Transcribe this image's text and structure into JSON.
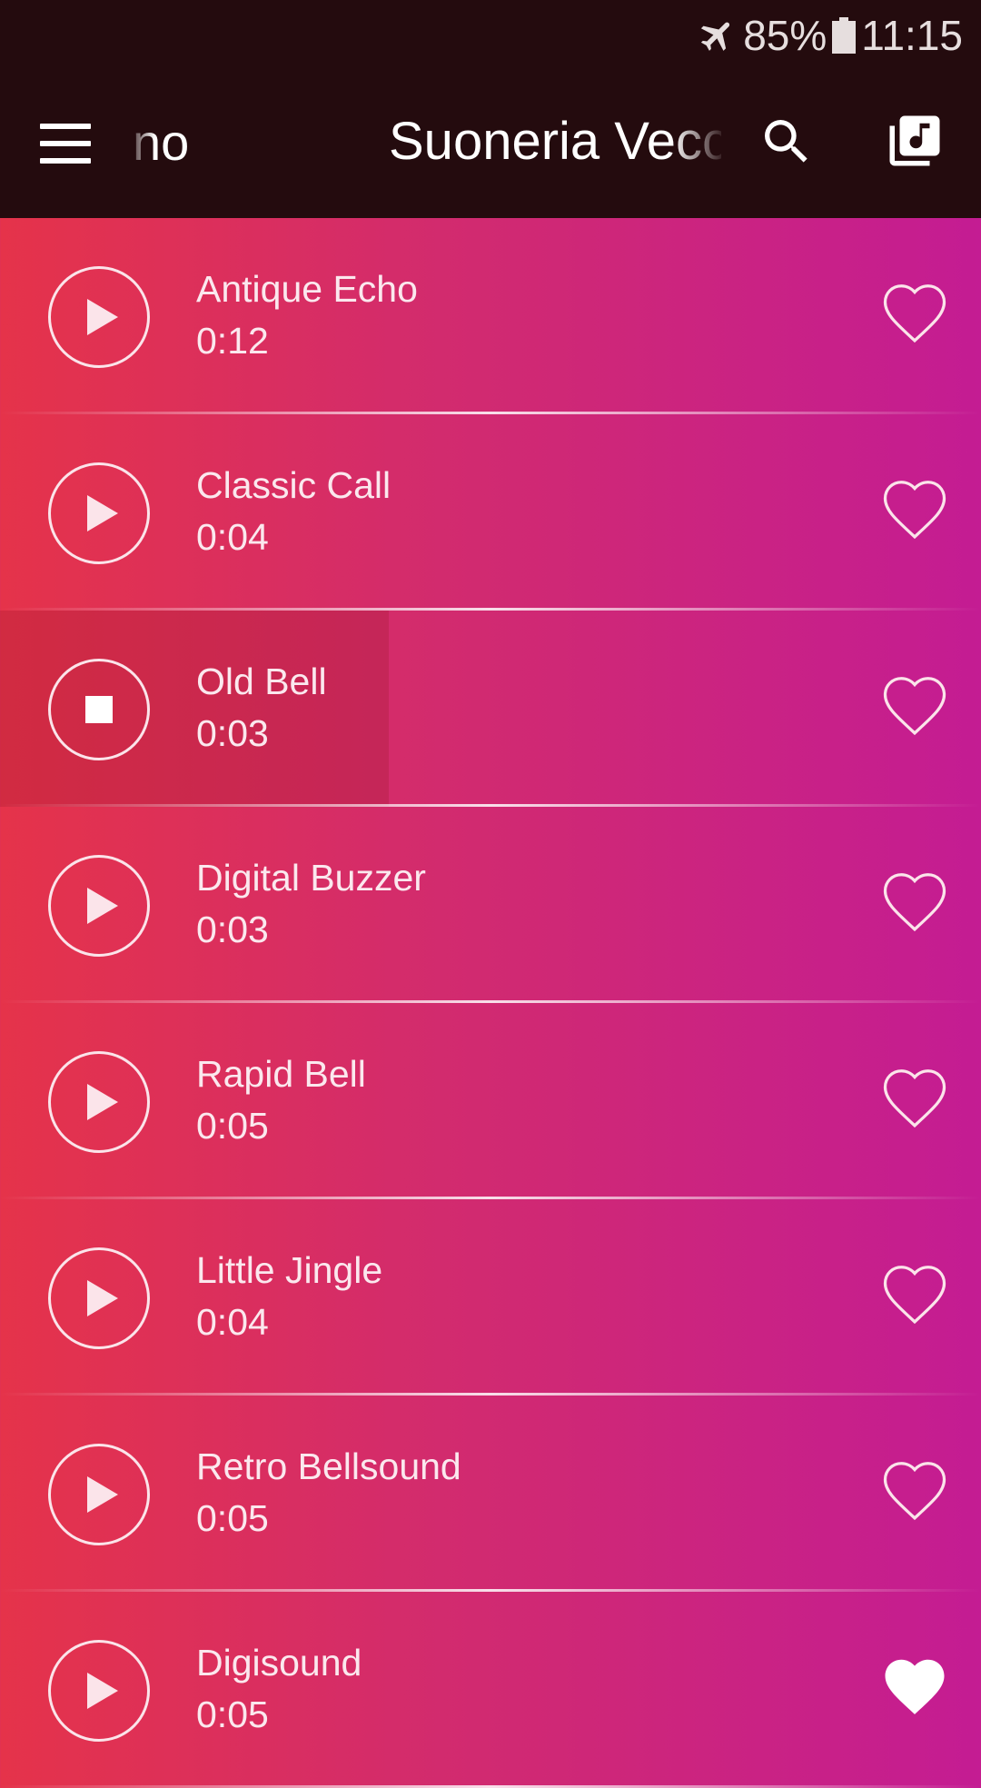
{
  "status_bar": {
    "battery": "85%",
    "time": "11:15",
    "icons": [
      "airplane-mode-icon",
      "battery-icon"
    ]
  },
  "app_bar": {
    "tab_fragment": "no",
    "title": "Suoneria Vecc",
    "icons": [
      "menu-icon",
      "search-icon",
      "music-library-icon"
    ]
  },
  "ringtones": [
    {
      "title": "Antique Echo",
      "duration": "0:12",
      "playing": false,
      "favorite": false
    },
    {
      "title": "Classic Call",
      "duration": "0:04",
      "playing": false,
      "favorite": false
    },
    {
      "title": "Old Bell",
      "duration": "0:03",
      "playing": true,
      "favorite": false
    },
    {
      "title": "Digital Buzzer",
      "duration": "0:03",
      "playing": false,
      "favorite": false
    },
    {
      "title": "Rapid Bell",
      "duration": "0:05",
      "playing": false,
      "favorite": false
    },
    {
      "title": "Little Jingle",
      "duration": "0:04",
      "playing": false,
      "favorite": false
    },
    {
      "title": "Retro Bellsound",
      "duration": "0:05",
      "playing": false,
      "favorite": false
    },
    {
      "title": "Digisound",
      "duration": "0:05",
      "playing": false,
      "favorite": true
    }
  ],
  "colors": {
    "gradient_left": "#e5334a",
    "gradient_right": "#c41c93",
    "toolbar": "#240b0e"
  }
}
